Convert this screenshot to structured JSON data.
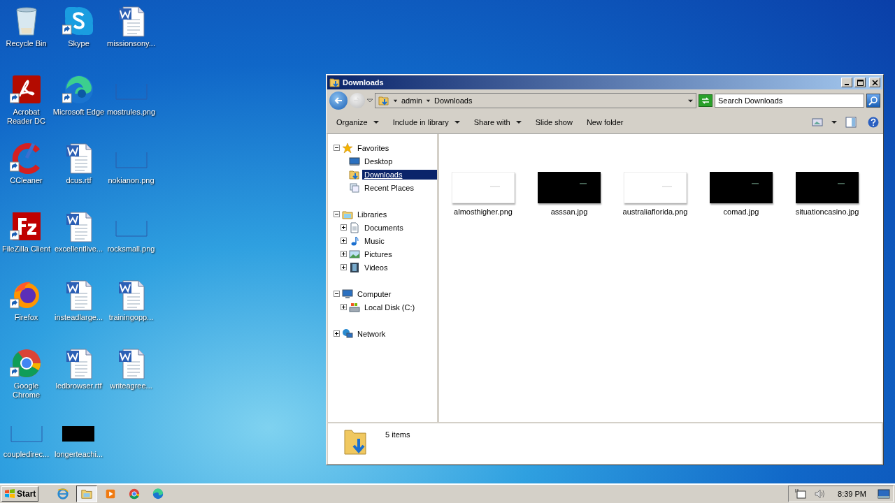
{
  "desktop": {
    "icons": [
      {
        "label": "Recycle Bin",
        "kind": "recycle",
        "shortcut": false
      },
      {
        "label": "Acrobat Reader DC",
        "kind": "acrobat",
        "shortcut": true
      },
      {
        "label": "CCleaner",
        "kind": "ccleaner",
        "shortcut": true
      },
      {
        "label": "FileZilla Client",
        "kind": "filezilla",
        "shortcut": true
      },
      {
        "label": "Firefox",
        "kind": "firefox",
        "shortcut": true
      },
      {
        "label": "Google Chrome",
        "kind": "chrome",
        "shortcut": true
      },
      {
        "label": "coupledirec...",
        "kind": "blank",
        "shortcut": false
      },
      {
        "label": "Skype",
        "kind": "skype",
        "shortcut": true
      },
      {
        "label": "Microsoft Edge",
        "kind": "edge",
        "shortcut": true
      },
      {
        "label": "dcus.rtf",
        "kind": "word",
        "shortcut": false
      },
      {
        "label": "excellentlive...",
        "kind": "word",
        "shortcut": false
      },
      {
        "label": "insteadlarge...",
        "kind": "word",
        "shortcut": false
      },
      {
        "label": "ledbrowser.rtf",
        "kind": "word",
        "shortcut": false
      },
      {
        "label": "longerteachi...",
        "kind": "dark",
        "shortcut": false
      },
      {
        "label": "missionsony...",
        "kind": "word",
        "shortcut": false
      },
      {
        "label": "mostrules.png",
        "kind": "blank",
        "shortcut": false
      },
      {
        "label": "nokianon.png",
        "kind": "blank",
        "shortcut": false
      },
      {
        "label": "rocksmall.png",
        "kind": "blank",
        "shortcut": false
      },
      {
        "label": "trainingopp...",
        "kind": "word",
        "shortcut": false
      },
      {
        "label": "writeagree...",
        "kind": "word",
        "shortcut": false
      }
    ]
  },
  "window": {
    "title": "Downloads",
    "address": {
      "crumbs": [
        "admin",
        "Downloads"
      ]
    },
    "search": {
      "placeholder": "Search Downloads"
    },
    "commands": [
      {
        "label": "Organize",
        "dropdown": true
      },
      {
        "label": "Include in library",
        "dropdown": true
      },
      {
        "label": "Share with",
        "dropdown": true
      },
      {
        "label": "Slide show",
        "dropdown": false
      },
      {
        "label": "New folder",
        "dropdown": false
      }
    ],
    "nav": [
      {
        "label": "Favorites",
        "kind": "star",
        "expanded": true,
        "children": [
          {
            "label": "Desktop",
            "kind": "desktop",
            "selected": false
          },
          {
            "label": "Downloads",
            "kind": "downloads",
            "selected": true
          },
          {
            "label": "Recent Places",
            "kind": "recent",
            "selected": false
          }
        ]
      },
      {
        "label": "Libraries",
        "kind": "library",
        "expanded": true,
        "children": [
          {
            "label": "Documents",
            "kind": "documents",
            "expanded": false,
            "selected": false
          },
          {
            "label": "Music",
            "kind": "music",
            "expanded": false,
            "selected": false
          },
          {
            "label": "Pictures",
            "kind": "pictures",
            "expanded": false,
            "selected": false
          },
          {
            "label": "Videos",
            "kind": "videos",
            "expanded": false,
            "selected": false
          }
        ]
      },
      {
        "label": "Computer",
        "kind": "computer",
        "expanded": true,
        "children": [
          {
            "label": "Local Disk (C:)",
            "kind": "disk",
            "expanded": false,
            "selected": false
          }
        ]
      },
      {
        "label": "Network",
        "kind": "network",
        "expanded": false
      }
    ],
    "files": [
      {
        "name": "almosthigher.png",
        "kind": "light"
      },
      {
        "name": "asssan.jpg",
        "kind": "dark"
      },
      {
        "name": "australiaflorida.png",
        "kind": "light"
      },
      {
        "name": "comad.jpg",
        "kind": "dark"
      },
      {
        "name": "situationcasino.jpg",
        "kind": "dark"
      }
    ],
    "status": "5 items"
  },
  "taskbar": {
    "start": "Start",
    "apps": [
      {
        "kind": "ie",
        "selected": false
      },
      {
        "kind": "explorer",
        "selected": true
      },
      {
        "kind": "media",
        "selected": false
      },
      {
        "kind": "chrome",
        "selected": false
      },
      {
        "kind": "edge",
        "selected": false
      }
    ],
    "clock": "8:39 PM"
  }
}
